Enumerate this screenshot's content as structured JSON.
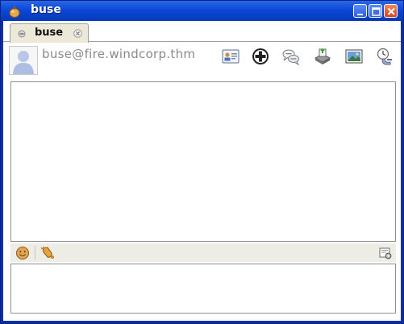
{
  "window": {
    "title": "buse",
    "icon": "gourd-app-icon",
    "controls": [
      "minimize",
      "maximize",
      "close"
    ]
  },
  "tabs": [
    {
      "label": "buse",
      "status_icon": "status-dot-icon",
      "close_icon": "close-icon"
    }
  ],
  "contact": {
    "jid": "buse@fire.windcorp.thm",
    "avatar": "default-avatar"
  },
  "toolbar_icons": [
    "vcard-icon",
    "add-contact-icon",
    "chat-bubbles-icon",
    "send-file-icon",
    "image-icon",
    "history-icon"
  ],
  "chat_toolbar": {
    "left_icons": [
      "emoticon-icon",
      "attention-icon"
    ],
    "right_icons": [
      "settings-icon"
    ]
  },
  "colors": {
    "titlebar": "#0b48d6",
    "jid_text": "#8a8a8a",
    "toolbar_bg": "#eeede5"
  }
}
